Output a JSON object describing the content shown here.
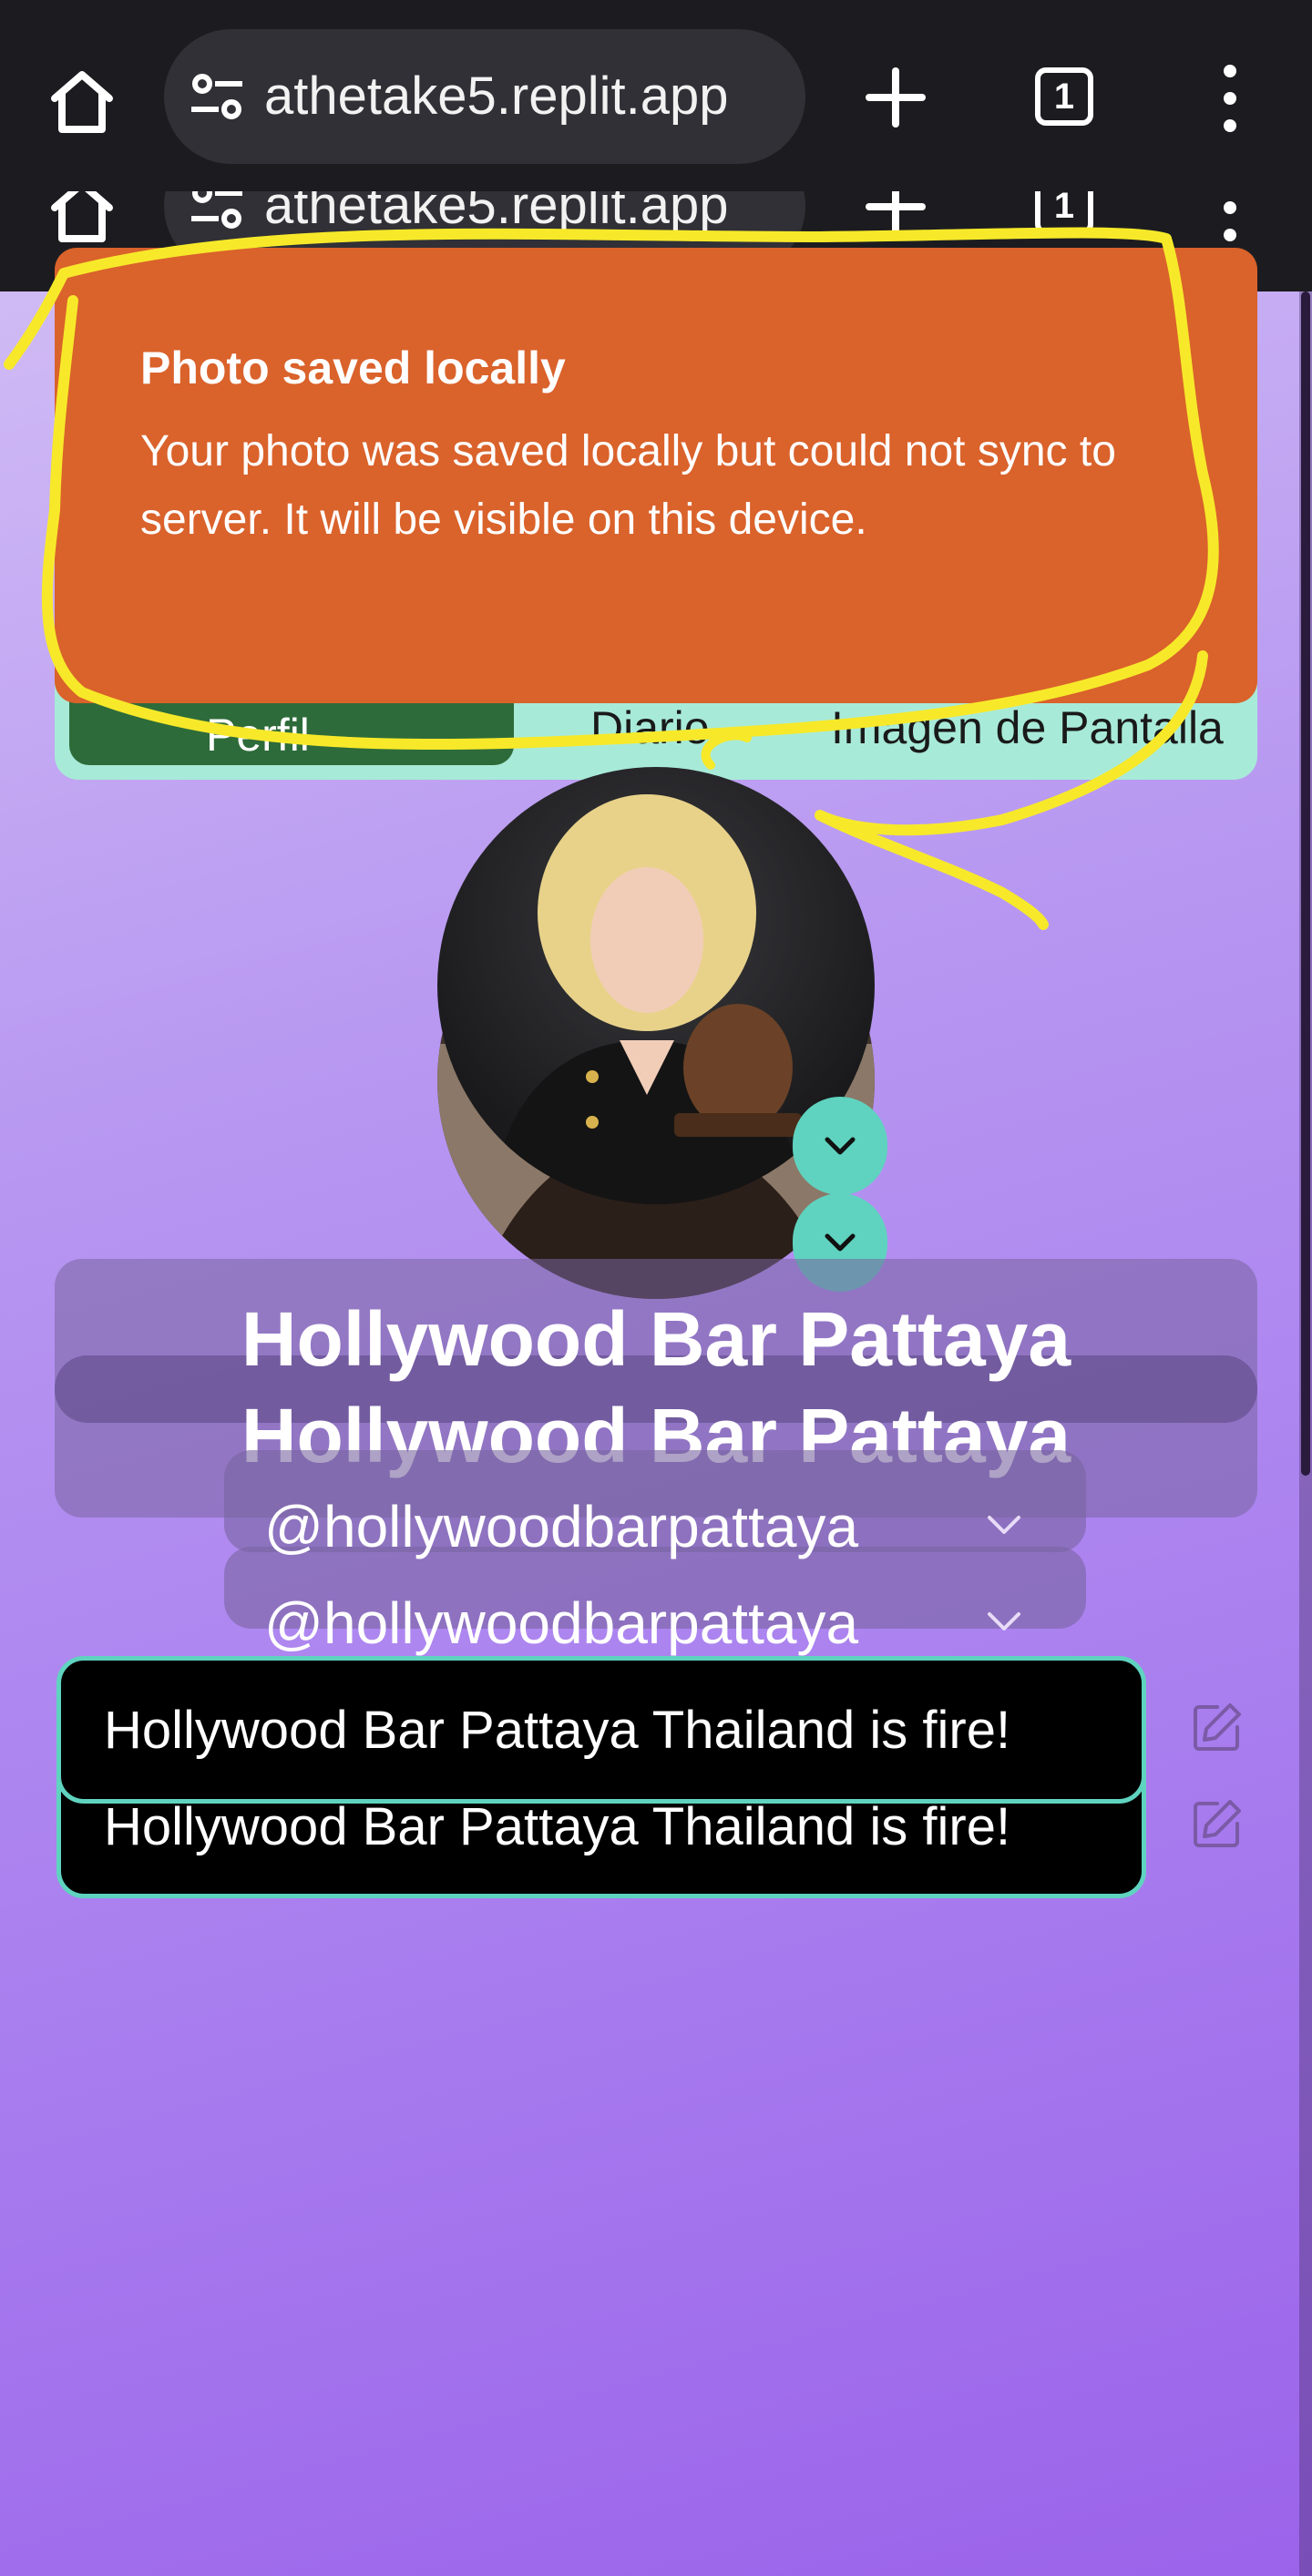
{
  "browser": {
    "url": "athetake5.replit.app",
    "tab_count": "1"
  },
  "nav": {
    "tabs": [
      {
        "label": "Perfil"
      },
      {
        "label": "Diario"
      },
      {
        "label": "Imagen de Pantalla"
      }
    ]
  },
  "toast": {
    "title": "Photo saved locally",
    "body": "Your photo was saved locally but could not sync to server. It will be visible on this device."
  },
  "profile": {
    "display_name": "Hollywood Bar Pattaya",
    "handle": "@hollywoodbarpattaya",
    "bio": "Hollywood Bar Pattaya Thailand is fire!"
  },
  "colors": {
    "toast_bg": "#da622b",
    "accent_teal": "#5fd3bf",
    "annotation_yellow": "#f7e92a",
    "nav_active": "#2e6b3a"
  }
}
